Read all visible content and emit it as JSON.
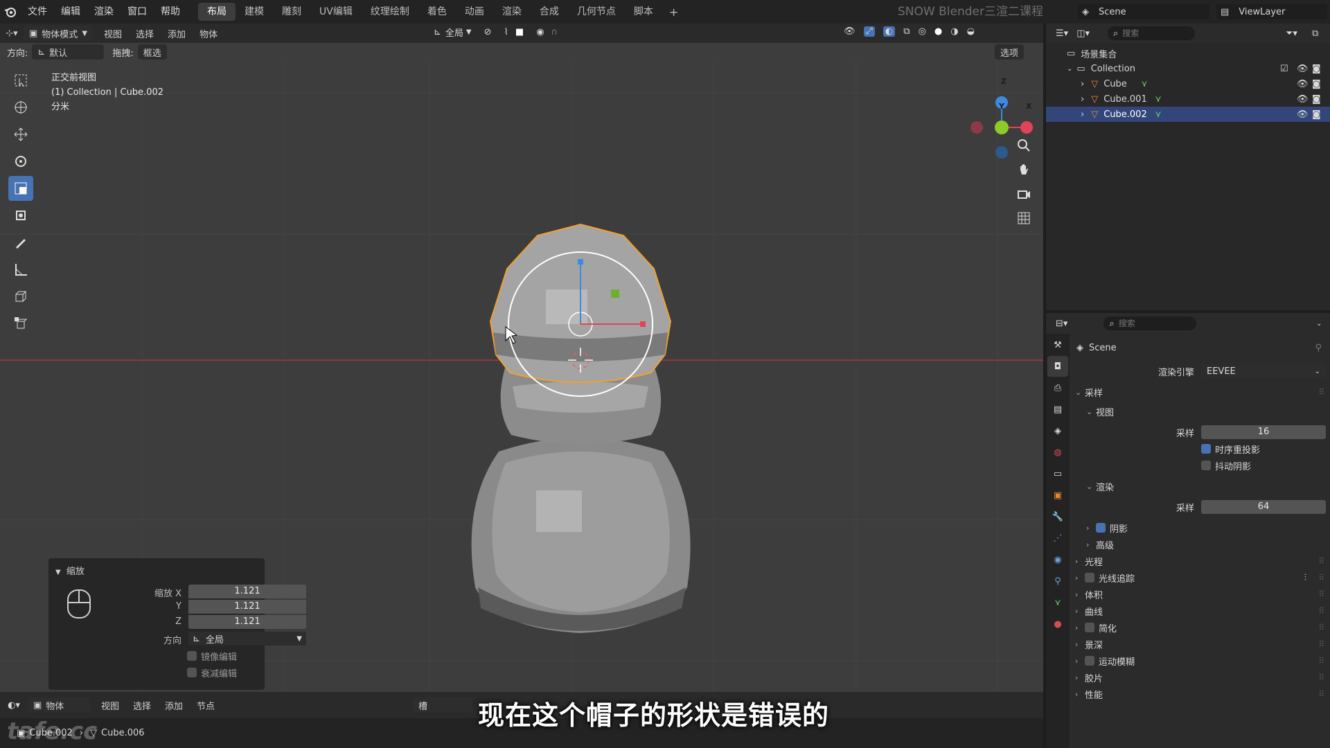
{
  "topbar": {
    "menus": [
      "文件",
      "编辑",
      "渲染",
      "窗口",
      "帮助"
    ],
    "workspaces": [
      "布局",
      "建模",
      "雕刻",
      "UV编辑",
      "纹理绘制",
      "着色",
      "动画",
      "渲染",
      "合成",
      "几何节点",
      "脚本"
    ],
    "active_workspace": "布局",
    "add_label": "+",
    "watermark": "SNOW Blender三渲二课程",
    "scene": "Scene",
    "view_layer": "ViewLayer"
  },
  "viewport_header": {
    "mode": "物体模式",
    "menus": [
      "视图",
      "选择",
      "添加",
      "物体"
    ],
    "transform_orientation": "全局",
    "orientation_label": "方向:",
    "orientation_value": "默认",
    "drag_label": "拖拽:",
    "drag_value": "框选",
    "options": "选项"
  },
  "viewport_overlay": {
    "view_name": "正交前视图",
    "collection_info": "(1) Collection | Cube.002",
    "unit": "分米"
  },
  "gizmo": {
    "z": "Z",
    "y": "Y",
    "x": "X"
  },
  "operator_panel": {
    "title": "缩放",
    "scale_x_label": "缩放 X",
    "scale_y_label": "Y",
    "scale_z_label": "Z",
    "scale_x": "1.121",
    "scale_y": "1.121",
    "scale_z": "1.121",
    "orientation_label": "方向",
    "orientation_value": "全局",
    "mirror_label": "镜像编辑",
    "falloff_label": "衰减编辑"
  },
  "bottom_editor": {
    "mode": "物体",
    "menus": [
      "视图",
      "选择",
      "添加",
      "节点"
    ],
    "slot": "槽"
  },
  "statusbar": {
    "object": "Cube.002",
    "mesh": "Cube.006",
    "logo_text": "tafe.cc"
  },
  "subtitle": "现在这个帽子的形状是错误的",
  "outliner": {
    "search_placeholder": "搜索",
    "scene_collection": "场景集合",
    "collection": "Collection",
    "objects": [
      {
        "name": "Cube",
        "selected": false
      },
      {
        "name": "Cube.001",
        "selected": false
      },
      {
        "name": "Cube.002",
        "selected": true
      }
    ]
  },
  "properties": {
    "search_placeholder": "搜索",
    "context": "Scene",
    "render_engine_label": "渲染引擎",
    "render_engine": "EEVEE",
    "sampling": "采样",
    "viewport": "视图",
    "viewport_samples_label": "采样",
    "viewport_samples": "16",
    "temporal_reprojection": "时序重投影",
    "jitter_shadows": "抖动阴影",
    "render": "渲染",
    "render_samples_label": "采样",
    "render_samples": "64",
    "shadows": "阴影",
    "advanced": "高级",
    "panels": [
      "光程",
      "光线追踪",
      "体积",
      "曲线",
      "简化",
      "景深",
      "运动模糊",
      "胶片",
      "性能"
    ]
  },
  "colors": {
    "accent": "#4772b3",
    "selection_outline": "#f0a030",
    "axis_x": "#e0445a",
    "axis_y": "#8ccb2a",
    "axis_z": "#3d8be0"
  }
}
